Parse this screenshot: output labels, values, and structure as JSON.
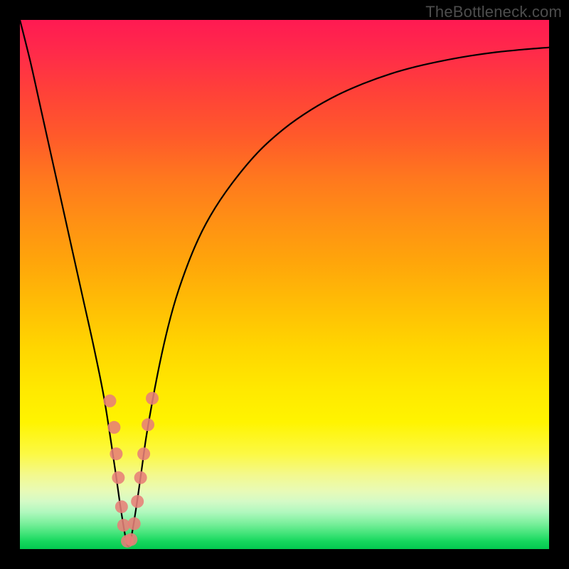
{
  "watermark": "TheBottleneck.com",
  "colors": {
    "curve": "#000000",
    "dot": "#e77e77",
    "frame": "#000000"
  },
  "chart_data": {
    "type": "line",
    "title": "",
    "xlabel": "",
    "ylabel": "",
    "xlim": [
      0,
      100
    ],
    "ylim": [
      0,
      100
    ],
    "series": [
      {
        "name": "bottleneck-curve",
        "x": [
          0,
          2,
          4,
          6,
          8,
          10,
          12,
          14,
          16,
          18,
          19,
          20,
          20.5,
          21,
          22,
          23,
          24,
          26,
          28,
          30,
          33,
          36,
          40,
          45,
          50,
          55,
          60,
          65,
          70,
          75,
          80,
          85,
          90,
          95,
          100
        ],
        "values": [
          100,
          92,
          83,
          74,
          65,
          56,
          47,
          38,
          28,
          15,
          8,
          2,
          0.5,
          2,
          8,
          15,
          22,
          33,
          42,
          49,
          57,
          63,
          69,
          75,
          79.5,
          83,
          85.8,
          88,
          89.8,
          91.2,
          92.3,
          93.2,
          93.9,
          94.4,
          94.8
        ]
      }
    ],
    "annotations": {
      "dots": [
        {
          "x": 17.0,
          "y": 28.0
        },
        {
          "x": 17.8,
          "y": 23.0
        },
        {
          "x": 18.2,
          "y": 18.0
        },
        {
          "x": 18.6,
          "y": 13.5
        },
        {
          "x": 19.2,
          "y": 8.0
        },
        {
          "x": 19.6,
          "y": 4.5
        },
        {
          "x": 20.3,
          "y": 1.5
        },
        {
          "x": 21.0,
          "y": 1.8
        },
        {
          "x": 21.6,
          "y": 4.8
        },
        {
          "x": 22.2,
          "y": 9.0
        },
        {
          "x": 22.8,
          "y": 13.5
        },
        {
          "x": 23.4,
          "y": 18.0
        },
        {
          "x": 24.2,
          "y": 23.5
        },
        {
          "x": 25.0,
          "y": 28.5
        }
      ],
      "dot_radius_px": 9
    }
  }
}
